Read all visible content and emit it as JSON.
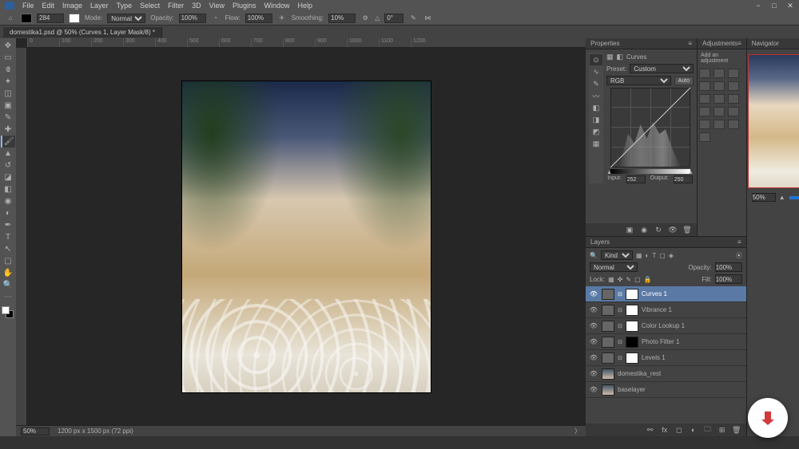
{
  "menu": [
    "File",
    "Edit",
    "Image",
    "Layer",
    "Type",
    "Select",
    "Filter",
    "3D",
    "View",
    "Plugins",
    "Window",
    "Help"
  ],
  "options": {
    "size": "284",
    "mode_label": "Mode:",
    "mode": "Normal",
    "opacity_label": "Opacity:",
    "opacity": "100%",
    "flow_label": "Flow:",
    "flow": "100%",
    "smoothing_label": "Smoothing:",
    "smoothing": "10%",
    "angle": "0°"
  },
  "tab": "domestika1.psd @ 50% (Curves 1, Layer Mask/8) *",
  "rulers": [
    "0",
    "100",
    "200",
    "300",
    "400",
    "500",
    "600",
    "700",
    "800",
    "900",
    "1000",
    "1100",
    "1200"
  ],
  "status": {
    "zoom": "50%",
    "dims": "1200 px x 1500 px (72 ppi)"
  },
  "properties": {
    "title": "Properties",
    "type": "Curves",
    "preset_label": "Preset:",
    "preset": "Custom",
    "channel": "RGB",
    "auto": "Auto",
    "input_label": "Input:",
    "input": "252",
    "output_label": "Output:",
    "output": "250"
  },
  "adjustments": {
    "title": "Adjustments",
    "subtitle": "Add an adjustment"
  },
  "navigator": {
    "title": "Navigator",
    "zoom": "50%"
  },
  "layers": {
    "title": "Layers",
    "kind_label": "Kind",
    "blend": "Normal",
    "opacity_label": "Opacity:",
    "opacity": "100%",
    "lock_label": "Lock:",
    "fill_label": "Fill:",
    "fill": "100%",
    "items": [
      {
        "name": "Curves 1",
        "sel": true,
        "adj": true
      },
      {
        "name": "Vibrance 1",
        "sel": false,
        "adj": true
      },
      {
        "name": "Color Lookup 1",
        "sel": false,
        "adj": true
      },
      {
        "name": "Photo Filter 1",
        "sel": false,
        "adj": true,
        "blackmask": true
      },
      {
        "name": "Levels 1",
        "sel": false,
        "adj": true
      },
      {
        "name": "domestika_rest",
        "sel": false,
        "adj": false
      },
      {
        "name": "baselayer",
        "sel": false,
        "adj": false
      }
    ]
  }
}
